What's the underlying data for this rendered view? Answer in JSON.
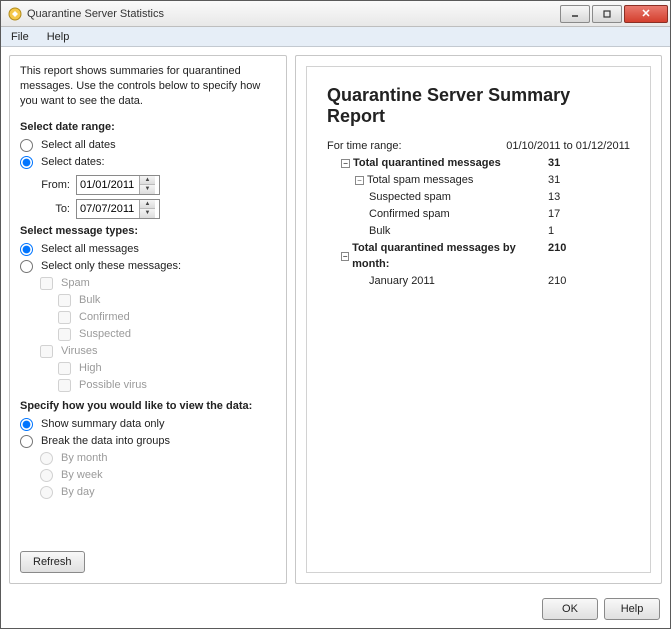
{
  "window": {
    "title": "Quarantine Server Statistics"
  },
  "menu": {
    "file": "File",
    "help": "Help"
  },
  "left": {
    "description": "This report shows summaries for quarantined messages. Use the controls below to specify how you want to see the data.",
    "date_range_header": "Select date range:",
    "select_all_dates": "Select all dates",
    "select_dates": "Select dates:",
    "from_label": "From:",
    "to_label": "To:",
    "from_value": "01/01/2011",
    "to_value": "07/07/2011",
    "msg_types_header": "Select message types:",
    "select_all_messages": "Select all messages",
    "select_only_these": "Select only these messages:",
    "spam": "Spam",
    "bulk": "Bulk",
    "confirmed": "Confirmed",
    "suspected": "Suspected",
    "viruses": "Viruses",
    "high": "High",
    "possible_virus": "Possible virus",
    "view_header": "Specify how you would like to view the data:",
    "show_summary": "Show summary data only",
    "break_groups": "Break the data into groups",
    "by_month": "By month",
    "by_week": "By week",
    "by_day": "By day",
    "refresh": "Refresh"
  },
  "report": {
    "title": "Quarantine Server Summary Report",
    "time_range_label": "For time range:",
    "time_range_value": "01/10/2011 to 01/12/2011",
    "total_quarantined_label": "Total quarantined messages",
    "total_quarantined_value": "31",
    "total_spam_label": "Total spam messages",
    "total_spam_value": "31",
    "suspected_spam_label": "Suspected spam",
    "suspected_spam_value": "13",
    "confirmed_spam_label": "Confirmed spam",
    "confirmed_spam_value": "17",
    "bulk_label": "Bulk",
    "bulk_value": "1",
    "by_month_label": "Total quarantined messages by month:",
    "by_month_value": "210",
    "jan_label": "January 2011",
    "jan_value": "210"
  },
  "buttons": {
    "ok": "OK",
    "help": "Help"
  }
}
